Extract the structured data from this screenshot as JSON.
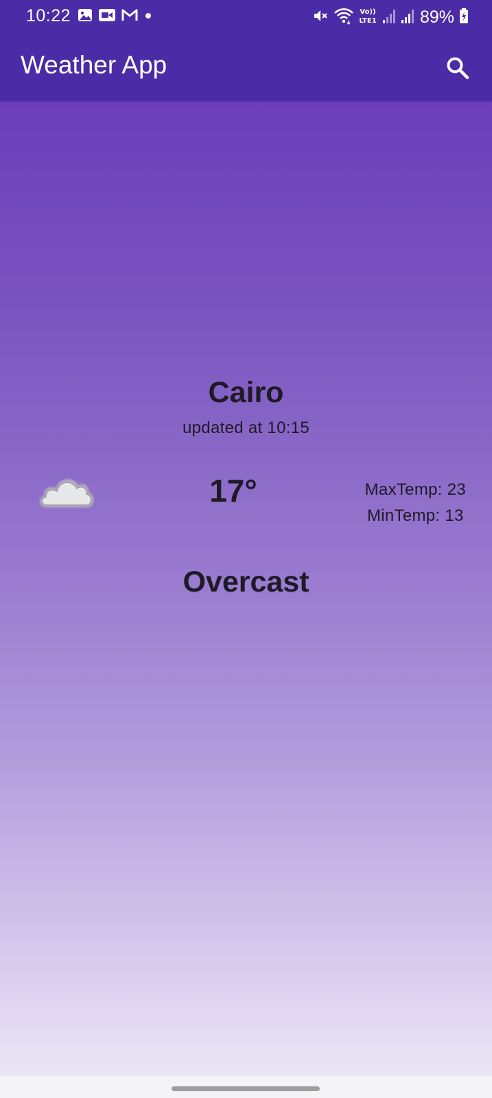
{
  "status_bar": {
    "time": "10:22",
    "battery": "89%",
    "left_icons": [
      "image-icon",
      "video-camera-icon",
      "gmail-icon",
      "dot-icon"
    ],
    "right_icons": [
      "mute-icon",
      "wifi-icon",
      "volte-icon",
      "signal-icon",
      "signal-icon",
      "battery-charging-icon"
    ],
    "volte_label": "Vo)) LTE1"
  },
  "app_bar": {
    "title": "Weather App",
    "search_icon": "search-icon"
  },
  "weather": {
    "city": "Cairo",
    "updated": "updated at 10:15",
    "icon": "cloud-icon",
    "temperature": "17°",
    "max_temp": "MaxTemp: 23",
    "min_temp": "MinTemp: 13",
    "condition": "Overcast"
  },
  "colors": {
    "app_bar": "#4c2ba6",
    "gradient_top": "#6b3eb9",
    "gradient_bottom": "#ebe6f5",
    "text": "#1e1a26"
  }
}
